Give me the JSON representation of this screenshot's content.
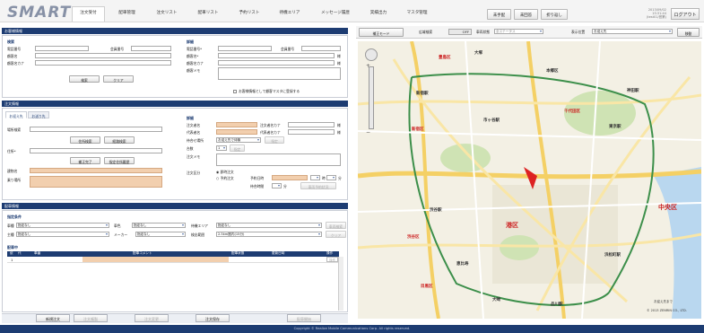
{
  "app": {
    "logo": "SMART"
  },
  "nav": {
    "tabs": [
      "注文受付",
      "配車管理",
      "注文リスト",
      "配車リスト",
      "予約リスト",
      "待機エリア",
      "メッセージ履歴",
      "実績出力",
      "マスタ管理"
    ],
    "active": 0
  },
  "top_buttons": {
    "b1": "未手配",
    "b2": "未回答",
    "b3": "折り返し"
  },
  "datetime": {
    "date": "2013/09/02 15:31:44",
    "user": "(test01/営業)"
  },
  "logout": "ログアウト",
  "customer": {
    "section_title": "お客様情報",
    "search": {
      "title": "検索",
      "phone": "電話番号",
      "member_no": "会員番号",
      "name": "顧客名",
      "kana": "顧客名カナ",
      "search_btn": "検索",
      "clear_btn": "クリア"
    },
    "detail": {
      "title": "詳細",
      "phone": "電話番号*",
      "member_no": "会員番号",
      "name": "顧客名*",
      "kana": "顧客名カナ",
      "memo": "顧客メモ",
      "sama1": "様",
      "sama2": "様",
      "register": "お客様情報として顧客マスタに登録する"
    }
  },
  "order": {
    "section_title": "注文情報",
    "tabs": [
      "お迎え先",
      "お送り先"
    ],
    "pickup": {
      "place_search": "場所検索",
      "address": "住所*",
      "addr_search": "住所検索",
      "route_search": "経路検索",
      "confirm": "補正完了",
      "history": "指定住所履歴",
      "building": "建物名",
      "meeting": "乗り場所"
    },
    "detail": {
      "title": "詳細",
      "orderer": "注文者名",
      "orderer_kana": "注文者名カナ",
      "rep": "代表者名",
      "rep_kana": "代表者名カナ",
      "wait": "待合せ場所",
      "wait_val": "お迎え先で待機",
      "count": "台数",
      "count_val": "1",
      "count_btn": "指定",
      "memo": "注文メモ",
      "category": "注文区分",
      "immediate": "即時注文",
      "reserve": "予約注文",
      "reserve_dt": "予約日時",
      "wait_time": "待合時間",
      "wait_unit": "分",
      "search_btn": "車両予約状況",
      "hour": "時",
      "minute": "分",
      "sama1": "様",
      "sama2": "様"
    }
  },
  "dispatch": {
    "section_title": "配車情報",
    "cond_title": "指定条件",
    "conds": {
      "vehicle": "車種",
      "vehicle_val": "指定なし",
      "color": "車色",
      "color_val": "指定なし",
      "area": "待機エリア",
      "area_val": "指定なし",
      "search_btn": "車両検索",
      "clear_btn": "クリア",
      "type": "主種",
      "type_val": "指定なし",
      "maker": "メーカー",
      "maker_val": "指定なし",
      "range": "検出範囲",
      "range_val": "2.5km圏内(15分)"
    },
    "list_title": "配車中",
    "columns": [
      "依",
      "代",
      "車番",
      "配車コメント",
      "配車状態",
      "更新日時",
      "操作"
    ],
    "rows": [
      {
        "no": "1"
      }
    ],
    "op_btn": "操作"
  },
  "bottom_buttons": [
    "新規注文",
    "注文複製",
    "注文変更",
    "注文保存",
    "配車開始"
  ],
  "map": {
    "mode_btn": "補正モード",
    "broad": "広域検索",
    "broad_val": "OFF",
    "vehicle_status": "車両状態",
    "vehicle_status_val": "全ステータス",
    "display": "表示位置",
    "display_val": "お迎え先",
    "move": "移動",
    "copyright": "© 2013 ZENRIN CO., LTD.",
    "scale": "お迎え先まで"
  },
  "map_labels": [
    "新宿駅",
    "新宿区",
    "渋谷駅",
    "渋谷区",
    "港区",
    "東京駅",
    "中央区",
    "神田駅",
    "品川駅",
    "豊島区",
    "千代田区",
    "目黒区",
    "本郷区",
    "大塚",
    "市ヶ谷駅",
    "恵比寿",
    "大崎",
    "浜松町駅"
  ],
  "footer": "Copyright © Realize Mobile Communications Corp. All rights reserved."
}
